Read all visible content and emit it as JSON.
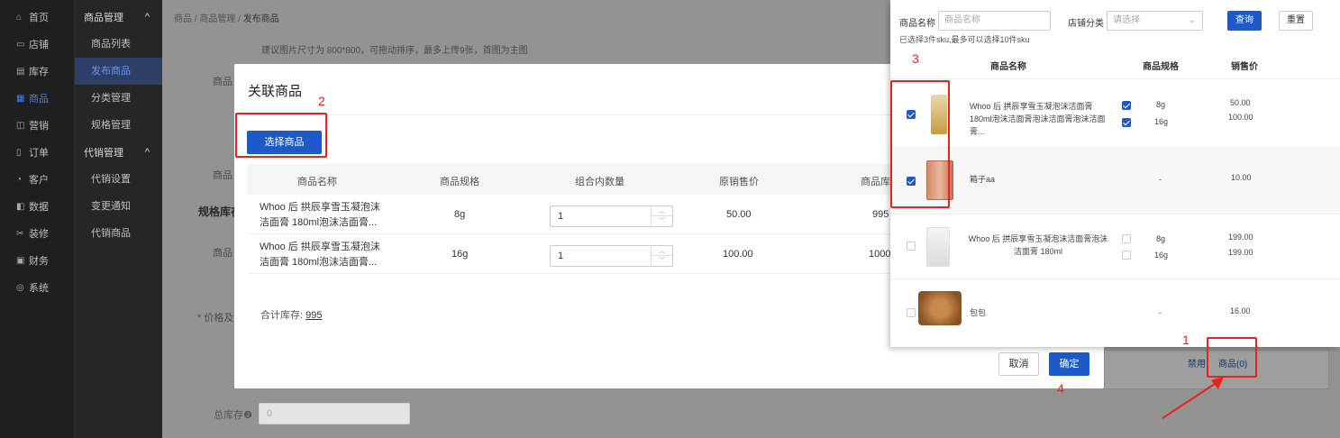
{
  "sidebar": {
    "items": [
      {
        "icon": "home-icon",
        "glyph": "⌂",
        "label": "首页"
      },
      {
        "icon": "store-icon",
        "glyph": "▭",
        "label": "店铺"
      },
      {
        "icon": "inventory-icon",
        "glyph": "▤",
        "label": "库存"
      },
      {
        "icon": "goods-icon",
        "glyph": "▦",
        "label": "商品"
      },
      {
        "icon": "marketing-icon",
        "glyph": "◫",
        "label": "营销"
      },
      {
        "icon": "order-icon",
        "glyph": "▯",
        "label": "订单"
      },
      {
        "icon": "customer-icon",
        "glyph": "◔",
        "label": "客户"
      },
      {
        "icon": "data-icon",
        "glyph": "◧",
        "label": "数据"
      },
      {
        "icon": "decorate-icon",
        "glyph": "✂",
        "label": "装修"
      },
      {
        "icon": "finance-icon",
        "glyph": "▣",
        "label": "财务"
      },
      {
        "icon": "system-icon",
        "glyph": "◎",
        "label": "系统"
      }
    ],
    "active": "商品"
  },
  "subnav": {
    "group1": "商品管理",
    "group1_items": [
      "商品列表",
      "发布商品",
      "分类管理",
      "规格管理"
    ],
    "group2": "代销管理",
    "group2_items": [
      "代销设置",
      "变更通知",
      "代销商品"
    ],
    "active": "发布商品",
    "chevron": "^"
  },
  "breadcrumb": {
    "a": "商品",
    "sep": "/",
    "b": "商品管理",
    "c": "发布商品"
  },
  "background": {
    "hint": "建议图片尺寸为 800*800，可拖动排序，最多上传9张，首图为主图",
    "label_goods1": "商品",
    "label_goods2": "商品",
    "label_goods3": "商品",
    "label_spec": "规格库存",
    "label_price": "* 价格及",
    "total_stock_label": "总库存",
    "total_stock_value": "0",
    "disable_text": "禁用",
    "goods_link": "商品(0)"
  },
  "modal": {
    "title": "关联商品",
    "select_button": "选择商品",
    "columns": [
      "商品名称",
      "商品规格",
      "组合内数量",
      "原销售价",
      "商品库存"
    ],
    "rows": [
      {
        "name": "Whoo 后 拱辰享雪玉凝泡沫洁面膏 180ml泡沫洁面膏...",
        "spec": "8g",
        "qty": "1",
        "price": "50.00",
        "stock": "995"
      },
      {
        "name": "Whoo 后 拱辰享雪玉凝泡沫洁面膏 180ml泡沫洁面膏...",
        "spec": "16g",
        "qty": "1",
        "price": "100.00",
        "stock": "1000"
      }
    ],
    "sum_label": "合计库存:",
    "sum_value": "995",
    "cancel": "取消",
    "ok": "确定"
  },
  "drawer": {
    "name_label": "商品名称",
    "name_placeholder": "商品名称",
    "shop_cat_label": "店铺分类",
    "shop_cat_placeholder": "请选择",
    "query": "查询",
    "reset": "重置",
    "selected_info": "已选择3件sku,最多可以选择10件sku",
    "columns": [
      "商品名称",
      "商品规格",
      "销售价"
    ],
    "items": [
      {
        "name": "Whoo 后 拱辰享雪玉凝泡沫洁面膏 180ml泡沫洁面膏泡沫洁面膏泡沫洁面膏...",
        "checked": true,
        "specs": [
          {
            "s": "8g",
            "p": "50.00",
            "c": true
          },
          {
            "s": "16g",
            "p": "100.00",
            "c": true
          }
        ]
      },
      {
        "name": "箱子aa",
        "checked": true,
        "spec": "-",
        "price": "10.00"
      },
      {
        "name": "Whoo 后 拱辰享雪玉凝泡沫洁面膏泡沫洁面膏 180ml",
        "checked": false,
        "specs": [
          {
            "s": "8g",
            "p": "199.00",
            "c": false
          },
          {
            "s": "16g",
            "p": "199.00",
            "c": false
          }
        ]
      },
      {
        "name": "包包",
        "checked": false,
        "spec": "-",
        "price": "16.00"
      }
    ]
  },
  "annotations": {
    "n1": "1",
    "n2": "2",
    "n3": "3",
    "n4": "4",
    "color": "#e8231b"
  }
}
